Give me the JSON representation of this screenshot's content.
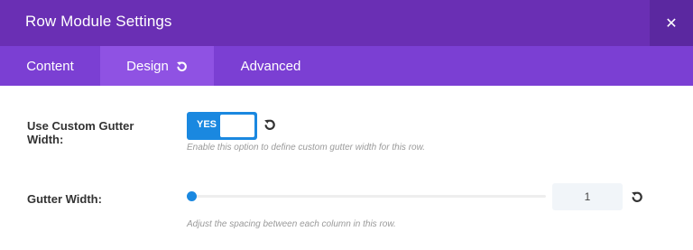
{
  "modal": {
    "title": "Row Module Settings"
  },
  "tabs": [
    {
      "label": "Content"
    },
    {
      "label": "Design"
    },
    {
      "label": "Advanced"
    }
  ],
  "settings": {
    "custom_gutter": {
      "label": "Use Custom Gutter Width:",
      "toggle_text": "YES",
      "enabled": true,
      "help": "Enable this option to define custom gutter width for this row."
    },
    "gutter_width": {
      "label": "Gutter Width:",
      "value": "1",
      "slider_fraction": 0,
      "help": "Adjust the spacing between each column in this row."
    }
  },
  "icons": {
    "close": "close-icon",
    "reset": "reset-icon"
  },
  "colors": {
    "header": "#6a2fb4",
    "tabs": "#7b3fd3",
    "active_tab": "#8f52e3",
    "accent": "#1a88e0"
  }
}
